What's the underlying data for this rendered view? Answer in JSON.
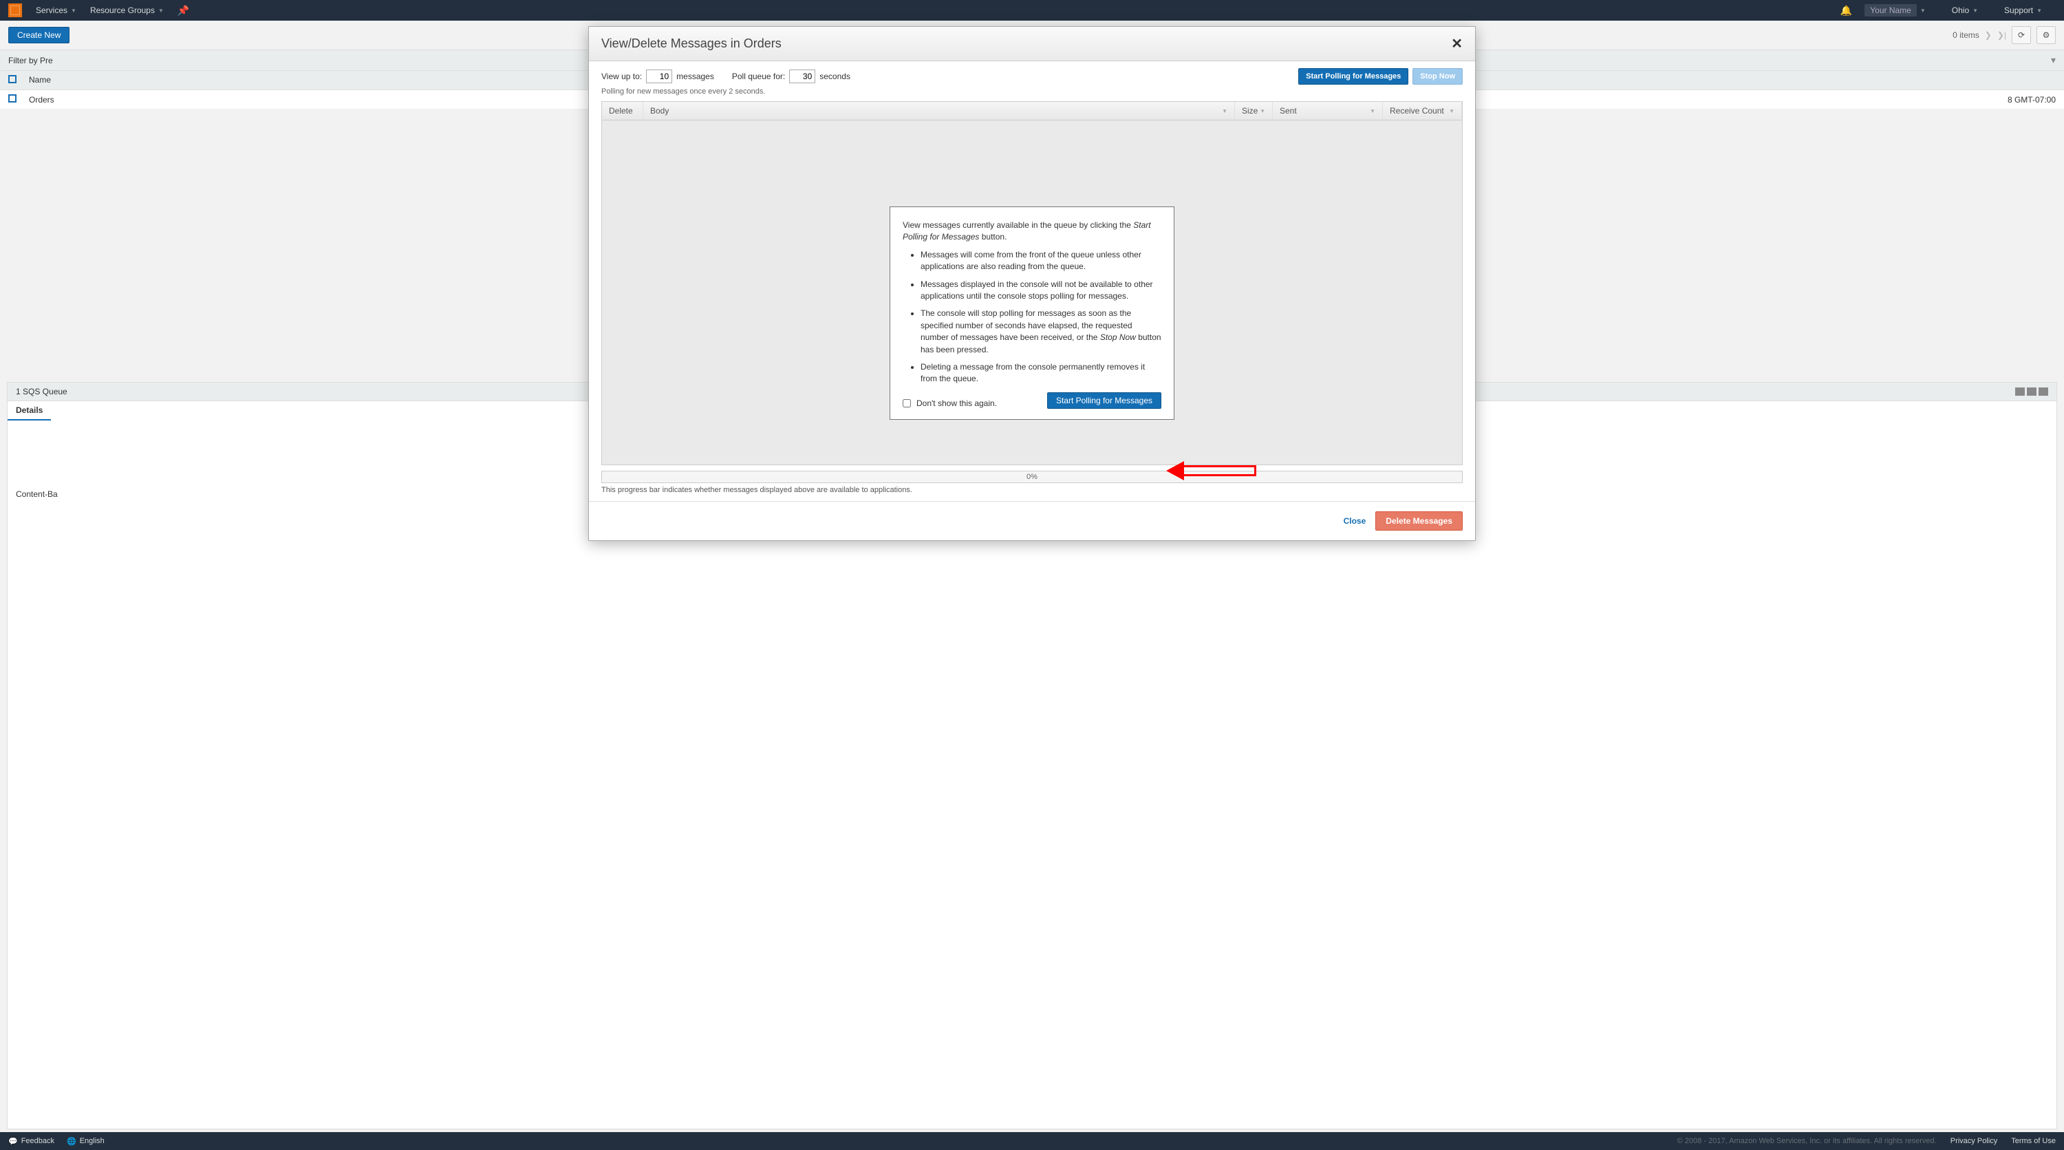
{
  "topnav": {
    "services": "Services",
    "resource_groups": "Resource Groups",
    "user": "Your Name",
    "region": "Ohio",
    "support": "Support"
  },
  "toolbar": {
    "create_new": "Create New",
    "items_label": "items",
    "items_partial": "0 items"
  },
  "subbar": {
    "filter": "Filter by Pre"
  },
  "grid": {
    "hdr_name": "Name",
    "row1": "Orders",
    "row1_time": "8 GMT-07:00"
  },
  "panel": {
    "title": "1 SQS Queue",
    "tab": "Details",
    "content_ba": "Content-Ba"
  },
  "footer": {
    "feedback": "Feedback",
    "language": "English",
    "copyright": "© 2008 - 2017, Amazon Web Services, Inc. or its affiliates. All rights reserved.",
    "privacy": "Privacy Policy",
    "terms": "Terms of Use"
  },
  "modal": {
    "title": "View/Delete Messages in Orders",
    "view_up_to_label": "View up to:",
    "view_up_to_value": "10",
    "messages_label": "messages",
    "poll_queue_label": "Poll queue for:",
    "poll_queue_value": "30",
    "seconds_label": "seconds",
    "start_polling": "Start Polling for Messages",
    "stop_now": "Stop Now",
    "polling_note": "Polling for new messages once every 2 seconds.",
    "cols": {
      "delete": "Delete",
      "body": "Body",
      "size": "Size",
      "sent": "Sent",
      "receive": "Receive Count"
    },
    "info_intro_1": "View messages currently available in the queue by clicking the ",
    "info_intro_em": "Start Polling for Messages",
    "info_intro_2": " button.",
    "bullets": [
      "Messages will come from the front of the queue unless other applications are also reading from the queue.",
      "Messages displayed in the console will not be available to other applications until the console stops polling for messages.",
      {
        "pre": "The console will stop polling for messages as soon as the specified number of seconds have elapsed, the requested number of messages have been received, or the ",
        "em": "Stop Now",
        "post": " button has been pressed."
      },
      "Deleting a message from the console permanently removes it from the queue."
    ],
    "dont_show": "Don't show this again.",
    "start_polling_btn2": "Start Polling for Messages",
    "progress_pct": "0%",
    "progress_note": "This progress bar indicates whether messages displayed above are available to applications.",
    "close": "Close",
    "delete_msgs": "Delete Messages"
  }
}
